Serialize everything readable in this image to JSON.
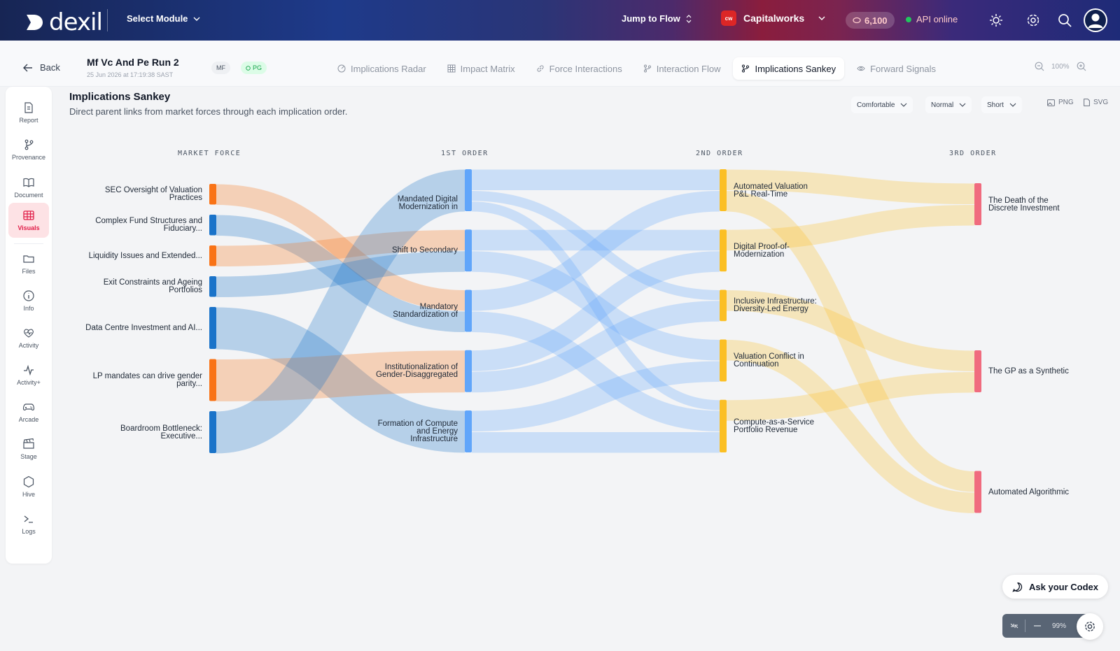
{
  "header": {
    "logo_text": "dexil",
    "select_module": "Select Module",
    "jump_to_flow": "Jump to Flow",
    "org_badge": "cw",
    "org_name": "Capitalworks",
    "credits": "6,100",
    "api_status": "API online"
  },
  "subheader": {
    "back_label": "Back",
    "run_title": "Mf Vc And Pe Run 2",
    "run_date": "25 Jun 2026 at 17:19:38 SAST",
    "tag_mf": "MF",
    "tag_pg": "PG",
    "tabs": [
      {
        "label": "Implications Radar",
        "icon": "radar-icon"
      },
      {
        "label": "Impact Matrix",
        "icon": "grid-icon"
      },
      {
        "label": "Force Interactions",
        "icon": "link-icon"
      },
      {
        "label": "Interaction Flow",
        "icon": "branch-icon"
      },
      {
        "label": "Implications Sankey",
        "icon": "branch-icon",
        "active": true
      },
      {
        "label": "Forward Signals",
        "icon": "eye-icon"
      }
    ],
    "zoom": "100%"
  },
  "rail": [
    {
      "label": "Report",
      "icon": "report-icon"
    },
    {
      "label": "Provenance",
      "icon": "provenance-icon"
    },
    {
      "label": "Document",
      "icon": "document-icon"
    },
    {
      "label": "Visuals",
      "icon": "visuals-icon",
      "active": true
    },
    {
      "label": "Files",
      "icon": "folder-icon"
    },
    {
      "label": "Info",
      "icon": "info-icon"
    },
    {
      "label": "Activity",
      "icon": "activity-heart-icon"
    },
    {
      "label": "Activity+",
      "icon": "activity-pulse-icon"
    },
    {
      "label": "Arcade",
      "icon": "gamepad-icon"
    },
    {
      "label": "Stage",
      "icon": "clapper-icon"
    },
    {
      "label": "Hive",
      "icon": "hexagon-icon"
    },
    {
      "label": "Logs",
      "icon": "terminal-icon"
    }
  ],
  "panel": {
    "title": "Implications Sankey",
    "subtitle": "Direct parent links from market forces through each implication order.",
    "density": "Comfortable",
    "size": "Normal",
    "label_length": "Short",
    "export_png": "PNG",
    "export_svg": "SVG"
  },
  "chart_data": {
    "type": "sankey",
    "columns": [
      "MARKET FORCE",
      "1ST ORDER",
      "2ND ORDER",
      "3RD ORDER"
    ],
    "colors": {
      "orange": "#f97316",
      "blue": "#1a73c9",
      "col1": "#60a5fa",
      "col2": "#fbbf24",
      "col3": "#f06b7e"
    },
    "nodes": [
      {
        "id": "m1",
        "col": 0,
        "label": "SEC Oversight of Valuation Practices",
        "color": "#f97316"
      },
      {
        "id": "m2",
        "col": 0,
        "label": "Complex Fund Structures and Fiduciary...",
        "color": "#1a73c9"
      },
      {
        "id": "m3",
        "col": 0,
        "label": "Liquidity Issues and Extended...",
        "color": "#f97316"
      },
      {
        "id": "m4",
        "col": 0,
        "label": "Exit Constraints and Ageing Portfolios",
        "color": "#1a73c9"
      },
      {
        "id": "m5",
        "col": 0,
        "label": "Data Centre Investment and AI...",
        "color": "#1a73c9"
      },
      {
        "id": "m6",
        "col": 0,
        "label": "LP mandates can drive gender parity...",
        "color": "#f97316"
      },
      {
        "id": "m7",
        "col": 0,
        "label": "Boardroom Bottleneck: Executive...",
        "color": "#1a73c9"
      },
      {
        "id": "f1",
        "col": 1,
        "label": "Mandated Digital Modernization in",
        "color": "#60a5fa"
      },
      {
        "id": "f2",
        "col": 1,
        "label": "Shift to Secondary",
        "color": "#60a5fa"
      },
      {
        "id": "f3",
        "col": 1,
        "label": "Mandatory Standardization of",
        "color": "#60a5fa"
      },
      {
        "id": "f4",
        "col": 1,
        "label": "Institutionalization of Gender-Disaggregated",
        "color": "#60a5fa"
      },
      {
        "id": "f5",
        "col": 1,
        "label": "Formation of Compute and Energy Infrastructure",
        "color": "#60a5fa"
      },
      {
        "id": "s1",
        "col": 2,
        "label": "Automated Valuation P&L Real-Time",
        "color": "#fbbf24"
      },
      {
        "id": "s2",
        "col": 2,
        "label": "Digital Proof-of-Modernization",
        "color": "#fbbf24"
      },
      {
        "id": "s3",
        "col": 2,
        "label": "Inclusive Infrastructure: Diversity-Led Energy",
        "color": "#fbbf24"
      },
      {
        "id": "s4",
        "col": 2,
        "label": "Valuation Conflict in Continuation",
        "color": "#fbbf24"
      },
      {
        "id": "s5",
        "col": 2,
        "label": "Compute-as-a-Service Portfolio Revenue",
        "color": "#fbbf24"
      },
      {
        "id": "t1",
        "col": 3,
        "label": "The Death of the Discrete Investment",
        "color": "#f06b7e"
      },
      {
        "id": "t2",
        "col": 3,
        "label": "The GP as a Synthetic",
        "color": "#f06b7e"
      },
      {
        "id": "t3",
        "col": 3,
        "label": "Automated Algorithmic",
        "color": "#f06b7e"
      }
    ],
    "links": [
      {
        "source": "m1",
        "target": "f3",
        "value": 1
      },
      {
        "source": "m2",
        "target": "f3",
        "value": 1
      },
      {
        "source": "m3",
        "target": "f2",
        "value": 1
      },
      {
        "source": "m4",
        "target": "f2",
        "value": 1
      },
      {
        "source": "m5",
        "target": "f5",
        "value": 2
      },
      {
        "source": "m6",
        "target": "f4",
        "value": 2
      },
      {
        "source": "m7",
        "target": "f1",
        "value": 2
      },
      {
        "source": "f1",
        "target": "s1",
        "value": 1
      },
      {
        "source": "f1",
        "target": "s3",
        "value": 0.5
      },
      {
        "source": "f1",
        "target": "s5",
        "value": 0.5
      },
      {
        "source": "f2",
        "target": "s2",
        "value": 1
      },
      {
        "source": "f2",
        "target": "s4",
        "value": 1
      },
      {
        "source": "f3",
        "target": "s1",
        "value": 1
      },
      {
        "source": "f3",
        "target": "s5",
        "value": 1
      },
      {
        "source": "f4",
        "target": "s2",
        "value": 1
      },
      {
        "source": "f4",
        "target": "s3",
        "value": 1
      },
      {
        "source": "f5",
        "target": "s4",
        "value": 1
      },
      {
        "source": "f5",
        "target": "s5",
        "value": 1
      },
      {
        "source": "s1",
        "target": "t1",
        "value": 1
      },
      {
        "source": "s1",
        "target": "t3",
        "value": 1
      },
      {
        "source": "s2",
        "target": "t1",
        "value": 1
      },
      {
        "source": "s3",
        "target": "t2",
        "value": 1
      },
      {
        "source": "s4",
        "target": "t3",
        "value": 1
      },
      {
        "source": "s5",
        "target": "t2",
        "value": 1
      }
    ]
  },
  "floating": {
    "codex_label": "Ask your Codex",
    "zoom": "99%"
  }
}
